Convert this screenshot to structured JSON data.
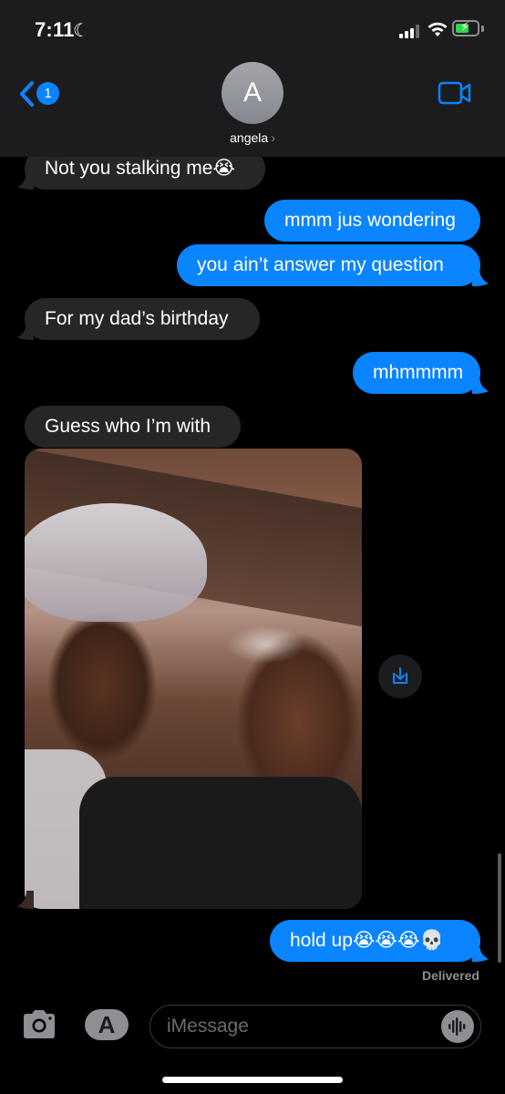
{
  "status_bar": {
    "time": "7:11"
  },
  "header": {
    "back_badge": "1",
    "avatar_initial": "A",
    "contact_name": "angela",
    "contact_chevron": "›"
  },
  "messages": [
    {
      "side": "recv",
      "text": "Not you stalking me😭"
    },
    {
      "side": "sent",
      "text": "mmm jus wondering"
    },
    {
      "side": "sent",
      "text": "you ain’t answer my question"
    },
    {
      "side": "recv",
      "text": "For my dad’s birthday"
    },
    {
      "side": "sent",
      "text": "mhmmmm"
    },
    {
      "side": "recv",
      "text": "Guess who I’m with"
    },
    {
      "side": "recv",
      "type": "photo"
    },
    {
      "side": "sent",
      "text": "hold up😭😭😭💀"
    }
  ],
  "delivered_label": "Delivered",
  "input": {
    "placeholder": "iMessage"
  },
  "icons": [
    "moon-icon",
    "signal-icon",
    "wifi-icon",
    "battery-icon",
    "back-chevron-icon",
    "video-camera-icon",
    "save-icon",
    "camera-icon",
    "app-store-icon",
    "audio-waveform-icon"
  ],
  "colors": {
    "sent_bubble": "#0a84ff",
    "received_bubble": "#262628",
    "header_bg": "#1c1c1e",
    "background": "#000000"
  }
}
